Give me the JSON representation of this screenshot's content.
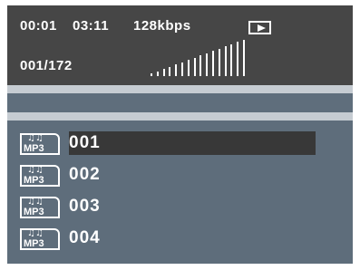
{
  "status": {
    "elapsed": "00:01",
    "total": "03:11",
    "bitrate": "128kbps",
    "play_state_icon": "play-icon",
    "track_position": "001/172",
    "level_meter_bar_count": 16
  },
  "file_list": {
    "items": [
      {
        "icon": "mp3-file-icon",
        "icon_label": "MP3",
        "name": "001",
        "selected": true
      },
      {
        "icon": "mp3-file-icon",
        "icon_label": "MP3",
        "name": "002",
        "selected": false
      },
      {
        "icon": "mp3-file-icon",
        "icon_label": "MP3",
        "name": "003",
        "selected": false
      },
      {
        "icon": "mp3-file-icon",
        "icon_label": "MP3",
        "name": "004",
        "selected": false
      }
    ]
  },
  "colors": {
    "status_panel": "#464646",
    "list_panel": "#5e6d7b",
    "selection": "#383838",
    "text": "#ffffff"
  }
}
